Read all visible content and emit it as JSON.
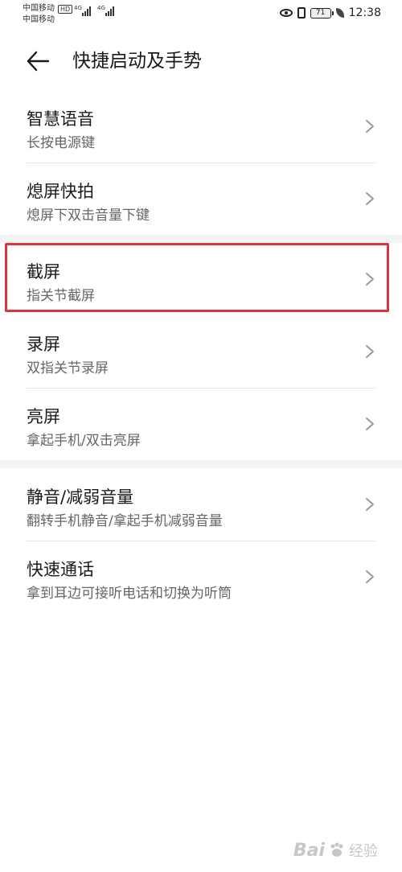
{
  "status_bar": {
    "carrier_1": "中国移动",
    "carrier_1_badge": "HD",
    "carrier_2": "中国移动",
    "network_1": "4G",
    "network_2": "4G",
    "battery_level": "71",
    "time": "12:38"
  },
  "header": {
    "title": "快捷启动及手势"
  },
  "groups": [
    {
      "items": [
        {
          "title": "智慧语音",
          "subtitle": "长按电源键"
        },
        {
          "title": "熄屏快拍",
          "subtitle": "熄屏下双击音量下键"
        }
      ]
    },
    {
      "items": [
        {
          "title": "截屏",
          "subtitle": "指关节截屏",
          "highlighted": true
        },
        {
          "title": "录屏",
          "subtitle": "双指关节录屏"
        },
        {
          "title": "亮屏",
          "subtitle": "拿起手机/双击亮屏"
        }
      ]
    },
    {
      "items": [
        {
          "title": "静音/减弱音量",
          "subtitle": "翻转手机静音/拿起手机减弱音量"
        },
        {
          "title": "快速通话",
          "subtitle": "拿到耳边可接听电话和切换为听筒"
        }
      ]
    }
  ],
  "colors": {
    "highlight": "#d9343b",
    "group_gap": "#f3f3f3",
    "subtitle": "#666666"
  },
  "icons": [
    "back-arrow-icon",
    "chevron-right-icon",
    "eye-icon",
    "vibrate-icon",
    "battery-icon",
    "leaf-icon"
  ],
  "watermark": {
    "text": "Bai",
    "suffix": "经验"
  }
}
